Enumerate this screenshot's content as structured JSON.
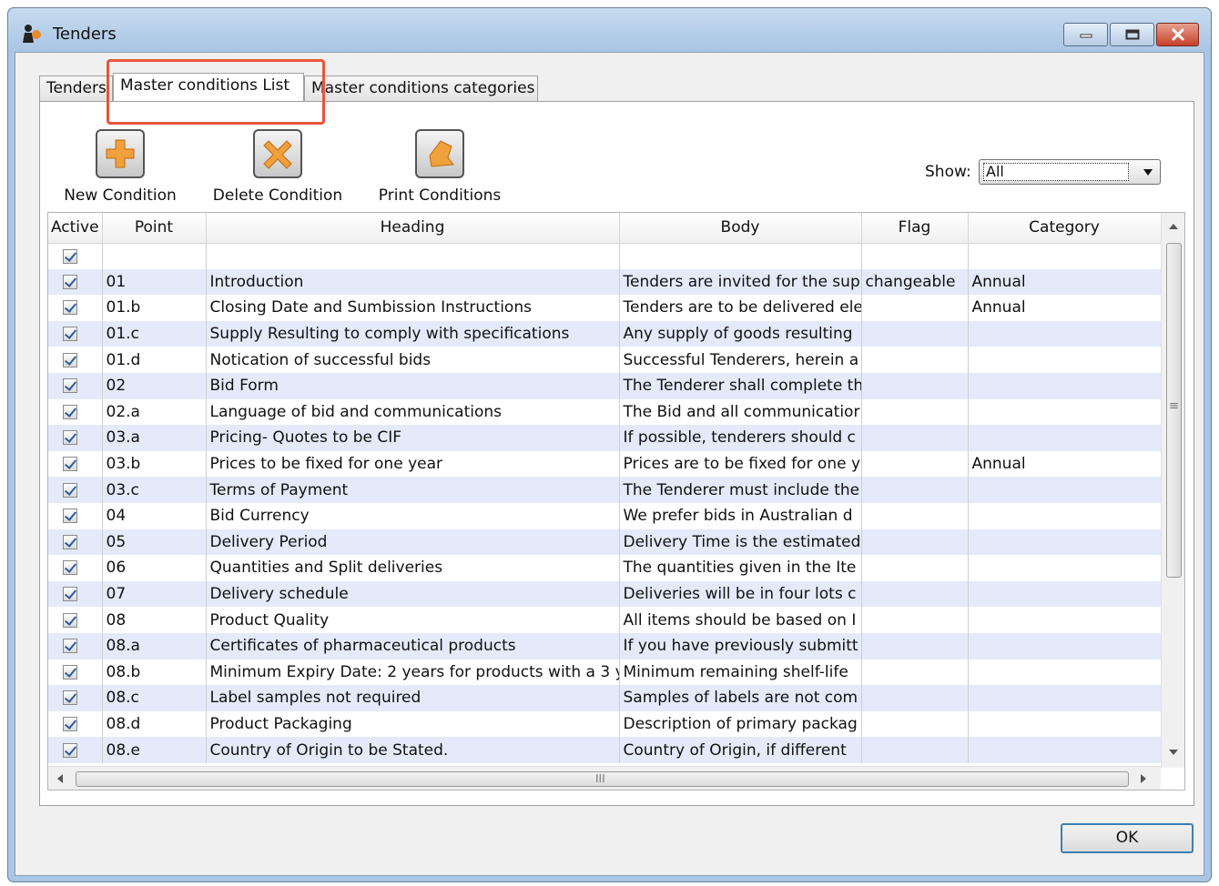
{
  "window": {
    "title": "Tenders"
  },
  "tabs": [
    {
      "label": "Tenders"
    },
    {
      "label": "Master conditions List"
    },
    {
      "label": "Master conditions categories"
    }
  ],
  "toolbar": {
    "new_label": "New Condition",
    "delete_label": "Delete Condition",
    "print_label": "Print Conditions"
  },
  "filter": {
    "show_label": "Show:",
    "show_value": "All"
  },
  "table": {
    "columns": [
      "Active",
      "Point",
      "Heading",
      "Body",
      "Flag",
      "Category"
    ],
    "rows": [
      {
        "active": true,
        "point": "",
        "heading": "",
        "body": "",
        "flag": "",
        "category": ""
      },
      {
        "active": true,
        "point": "01",
        "heading": "Introduction",
        "body": "Tenders are invited for the sup",
        "flag": "changeable",
        "category": "Annual"
      },
      {
        "active": true,
        "point": "01.b",
        "heading": "Closing Date and Sumbission Instructions",
        "body": "Tenders are to be delivered ele",
        "flag": "",
        "category": "Annual"
      },
      {
        "active": true,
        "point": "01.c",
        "heading": "Supply Resulting to comply with specifications",
        "body": "Any supply of goods resulting",
        "flag": "",
        "category": ""
      },
      {
        "active": true,
        "point": "01.d",
        "heading": "Notication of successful bids",
        "body": "Successful Tenderers, herein a",
        "flag": "",
        "category": ""
      },
      {
        "active": true,
        "point": "02",
        "heading": "Bid Form",
        "body": "The Tenderer shall complete th",
        "flag": "",
        "category": ""
      },
      {
        "active": true,
        "point": "02.a",
        "heading": "Language of bid and communications",
        "body": "The Bid and all communicatior",
        "flag": "",
        "category": ""
      },
      {
        "active": true,
        "point": "03.a",
        "heading": "Pricing- Quotes to be CIF",
        "body": "If possible, tenderers should c",
        "flag": "",
        "category": ""
      },
      {
        "active": true,
        "point": "03.b",
        "heading": "Prices to be fixed for one year",
        "body": "Prices are to be fixed for one y",
        "flag": "",
        "category": "Annual"
      },
      {
        "active": true,
        "point": "03.c",
        "heading": "Terms of Payment",
        "body": "The Tenderer must include the",
        "flag": "",
        "category": ""
      },
      {
        "active": true,
        "point": "04",
        "heading": "Bid Currency",
        "body": "We prefer bids in Australian d",
        "flag": "",
        "category": ""
      },
      {
        "active": true,
        "point": "05",
        "heading": "Delivery Period",
        "body": "Delivery Time is the estimated",
        "flag": "",
        "category": ""
      },
      {
        "active": true,
        "point": "06",
        "heading": "Quantities and Split deliveries",
        "body": "The quantities given in the Ite",
        "flag": "",
        "category": ""
      },
      {
        "active": true,
        "point": "07",
        "heading": "Delivery schedule",
        "body": "Deliveries will be in four lots c",
        "flag": "",
        "category": ""
      },
      {
        "active": true,
        "point": "08",
        "heading": "Product Quality",
        "body": "All items should be based on I",
        "flag": "",
        "category": ""
      },
      {
        "active": true,
        "point": "08.a",
        "heading": "Certificates of pharmaceutical products",
        "body": "If you have previously submitt",
        "flag": "",
        "category": ""
      },
      {
        "active": true,
        "point": "08.b",
        "heading": "Minimum Expiry Date: 2 years for products with a 3 y",
        "body": "Minimum remaining shelf-life",
        "flag": "",
        "category": ""
      },
      {
        "active": true,
        "point": "08.c",
        "heading": "Label samples not required",
        "body": "Samples of labels are not com",
        "flag": "",
        "category": ""
      },
      {
        "active": true,
        "point": "08.d",
        "heading": "Product Packaging",
        "body": "Description of primary packag",
        "flag": "",
        "category": ""
      },
      {
        "active": true,
        "point": "08.e",
        "heading": "Country of Origin to be Stated.",
        "body": "Country of Origin, if different",
        "flag": "",
        "category": ""
      }
    ]
  },
  "hscroll_grip": "III",
  "vscroll_grip": "≡",
  "ok_label": "OK",
  "colors": {
    "window_frame": "#a9c6e4",
    "row_alt": "#e4eafa",
    "highlight_box": "#e8543a",
    "icon_orange": "#f0a03c"
  },
  "icons": [
    "app-icon",
    "minimize-icon",
    "maximize-icon",
    "close-icon",
    "plus-icon",
    "x-icon",
    "print-icon",
    "checkbox-icon",
    "dropdown-arrow-icon"
  ]
}
